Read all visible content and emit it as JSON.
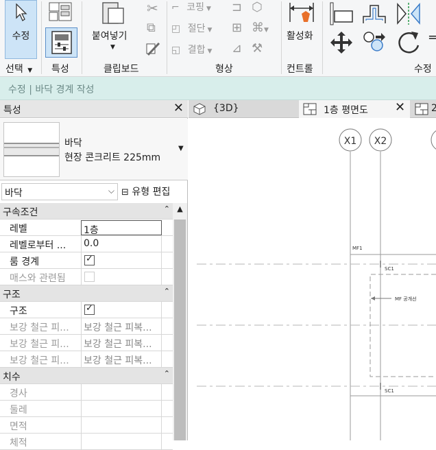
{
  "ribbon": {
    "modify": {
      "label": "수정"
    },
    "paste": {
      "label": "붙여넣기"
    },
    "clipboard_tools": {
      "cope": "코핑",
      "cut_geom": "절단",
      "join": "결합"
    },
    "activate": {
      "label": "활성화"
    },
    "groups": {
      "select": "선택",
      "properties": "특성",
      "clipboard": "클립보드",
      "geometry": "형상",
      "control": "컨트롤",
      "modify": "수정"
    }
  },
  "context_bar": {
    "text": "수정 | 바닥 경계 작성"
  },
  "properties_panel": {
    "title": "특성",
    "type_selector": {
      "family": "바닥",
      "type": "현장 콘크리트 225mm"
    },
    "filter": {
      "value": "바닥"
    },
    "edit_type_label": "유형 편집",
    "sections": [
      {
        "name": "구속조건",
        "rows": [
          {
            "key": "레벨",
            "value": "1층",
            "kind": "text",
            "editing": true
          },
          {
            "key": "레벨로부터 ...",
            "value": "0.0",
            "kind": "text"
          },
          {
            "key": "룸 경계",
            "kind": "checkbox",
            "checked": true
          },
          {
            "key": "매스와 관련됨",
            "kind": "checkbox",
            "checked": false,
            "disabled": true
          }
        ]
      },
      {
        "name": "구조",
        "rows": [
          {
            "key": "구조",
            "kind": "checkbox",
            "checked": true
          },
          {
            "key": "보강 철근 피...",
            "value": "보강 철근 피복...",
            "kind": "text",
            "dim": true
          },
          {
            "key": "보강 철근 피...",
            "value": "보강 철근 피복...",
            "kind": "text",
            "dim": true
          },
          {
            "key": "보강 철근 피...",
            "value": "보강 철근 피복...",
            "kind": "text",
            "dim": true
          }
        ]
      },
      {
        "name": "치수",
        "rows": [
          {
            "key": "경사",
            "value": "",
            "kind": "text",
            "dim": true
          },
          {
            "key": "둘레",
            "value": "",
            "kind": "text",
            "dim": true
          },
          {
            "key": "면적",
            "value": "",
            "kind": "text",
            "dim": true
          },
          {
            "key": "체적",
            "value": "",
            "kind": "text",
            "dim": true
          }
        ]
      }
    ]
  },
  "view_tabs": [
    {
      "label": "{3D}",
      "icon": "3d-cube-icon",
      "active": false
    },
    {
      "label": "1층 평면도",
      "icon": "floor-plan-icon",
      "active": true
    },
    {
      "label": "2",
      "icon": "floor-plan-icon",
      "active": false
    }
  ],
  "drawing": {
    "grid_bubbles": [
      "X1",
      "X2"
    ],
    "labels": [
      "MF1",
      "SC1",
      "MF 공개선",
      "SC1"
    ]
  }
}
